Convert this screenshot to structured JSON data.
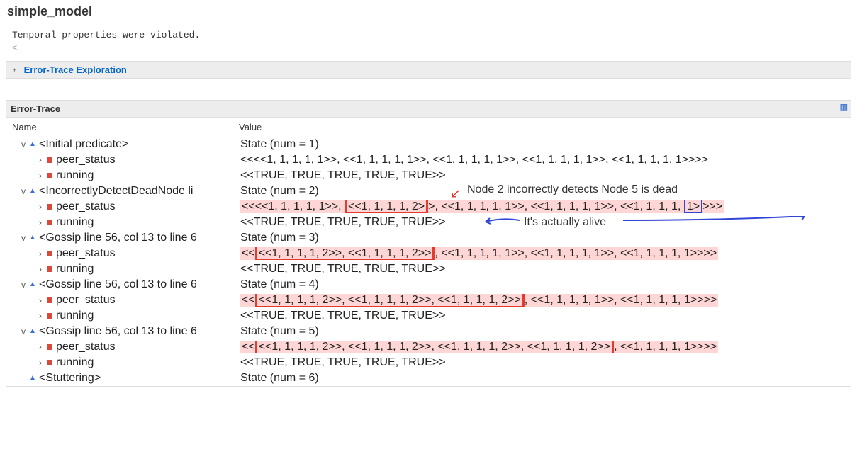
{
  "title": "simple_model",
  "message_text": "Temporal properties were violated.",
  "nav_back": "<",
  "section_exploration_label": "Error-Trace Exploration",
  "section_trace_label": "Error-Trace",
  "columns": {
    "name": "Name",
    "value": "Value"
  },
  "rows": [
    {
      "kind": "state",
      "indent": 0,
      "twisty": "v",
      "icon": "tri",
      "name": "<Initial predicate>",
      "value": "State (num = 1)",
      "hl": false
    },
    {
      "kind": "var",
      "indent": 1,
      "twisty": ">",
      "icon": "sq",
      "name": "peer_status",
      "value_parts": [
        {
          "t": "<<<<1, 1, 1, 1, 1>>, <<1, 1, 1, 1, 1>>, <<1, 1, 1, 1, 1>>, <<1, 1, 1, 1, 1>>, <<1, 1, 1, 1, 1>>>>"
        }
      ],
      "hl": false
    },
    {
      "kind": "var",
      "indent": 1,
      "twisty": ">",
      "icon": "sq",
      "name": "running",
      "value_parts": [
        {
          "t": "<<TRUE, TRUE, TRUE, TRUE, TRUE>>"
        }
      ],
      "hl": false
    },
    {
      "kind": "state",
      "indent": 0,
      "twisty": "v",
      "icon": "tri",
      "name": "<IncorrectlyDetectDeadNode li",
      "value": "State (num = 2)",
      "hl": false,
      "annot1": "Node 2 incorrectly detects Node 5 is dead"
    },
    {
      "kind": "var",
      "indent": 1,
      "twisty": ">",
      "icon": "sq",
      "name": "peer_status",
      "value_parts": [
        {
          "t": "<<<<1, 1, 1, 1, 1>>, "
        },
        {
          "t": "<<1, 1, 1, 1, 2>",
          "box": "red"
        },
        {
          "t": ">, <<1, 1, 1, 1, 1>>, <<1, 1, 1, 1, 1>>, <<1, 1, 1, 1, "
        },
        {
          "t": "1>",
          "box": "blue"
        },
        {
          "t": ">>>"
        }
      ],
      "hl": true
    },
    {
      "kind": "var",
      "indent": 1,
      "twisty": ">",
      "icon": "sq",
      "name": "running",
      "value_parts": [
        {
          "t": "<<TRUE, TRUE, TRUE, TRUE, TRUE>>"
        }
      ],
      "hl": false,
      "annot2": "It's actually alive"
    },
    {
      "kind": "state",
      "indent": 0,
      "twisty": "v",
      "icon": "tri",
      "name": "<Gossip line 56, col 13 to line 6",
      "value": "State (num = 3)",
      "hl": false
    },
    {
      "kind": "var",
      "indent": 1,
      "twisty": ">",
      "icon": "sq",
      "name": "peer_status",
      "value_parts": [
        {
          "t": "<<"
        },
        {
          "t": "<<1, 1, 1, 1, 2>>, <<1, 1, 1, 1, 2>>",
          "box": "red"
        },
        {
          "t": ", <<1, 1, 1, 1, 1>>, <<1, 1, 1, 1, 1>>, <<1, 1, 1, 1, 1>>>>"
        }
      ],
      "hl": true
    },
    {
      "kind": "var",
      "indent": 1,
      "twisty": ">",
      "icon": "sq",
      "name": "running",
      "value_parts": [
        {
          "t": "<<TRUE, TRUE, TRUE, TRUE, TRUE>>"
        }
      ],
      "hl": false
    },
    {
      "kind": "state",
      "indent": 0,
      "twisty": "v",
      "icon": "tri",
      "name": "<Gossip line 56, col 13 to line 6",
      "value": "State (num = 4)",
      "hl": false
    },
    {
      "kind": "var",
      "indent": 1,
      "twisty": ">",
      "icon": "sq",
      "name": "peer_status",
      "value_parts": [
        {
          "t": "<<"
        },
        {
          "t": "<<1, 1, 1, 1, 2>>, <<1, 1, 1, 1, 2>>, <<1, 1, 1, 1, 2>>",
          "box": "red"
        },
        {
          "t": ", <<1, 1, 1, 1, 1>>, <<1, 1, 1, 1, 1>>>>"
        }
      ],
      "hl": true
    },
    {
      "kind": "var",
      "indent": 1,
      "twisty": ">",
      "icon": "sq",
      "name": "running",
      "value_parts": [
        {
          "t": "<<TRUE, TRUE, TRUE, TRUE, TRUE>>"
        }
      ],
      "hl": false
    },
    {
      "kind": "state",
      "indent": 0,
      "twisty": "v",
      "icon": "tri",
      "name": "<Gossip line 56, col 13 to line 6",
      "value": "State (num = 5)",
      "hl": false
    },
    {
      "kind": "var",
      "indent": 1,
      "twisty": ">",
      "icon": "sq",
      "name": "peer_status",
      "value_parts": [
        {
          "t": "<<"
        },
        {
          "t": "<<1, 1, 1, 1, 2>>, <<1, 1, 1, 1, 2>>, <<1, 1, 1, 1, 2>>, <<1, 1, 1, 1, 2>>",
          "box": "red"
        },
        {
          "t": ", <<1, 1, 1, 1, 1>>>>"
        }
      ],
      "hl": true
    },
    {
      "kind": "var",
      "indent": 1,
      "twisty": ">",
      "icon": "sq",
      "name": "running",
      "value_parts": [
        {
          "t": "<<TRUE, TRUE, TRUE, TRUE, TRUE>>"
        }
      ],
      "hl": false
    },
    {
      "kind": "state",
      "indent": 0,
      "twisty": "",
      "icon": "tri",
      "name": "<Stuttering>",
      "value": "State (num = 6)",
      "hl": false
    }
  ]
}
